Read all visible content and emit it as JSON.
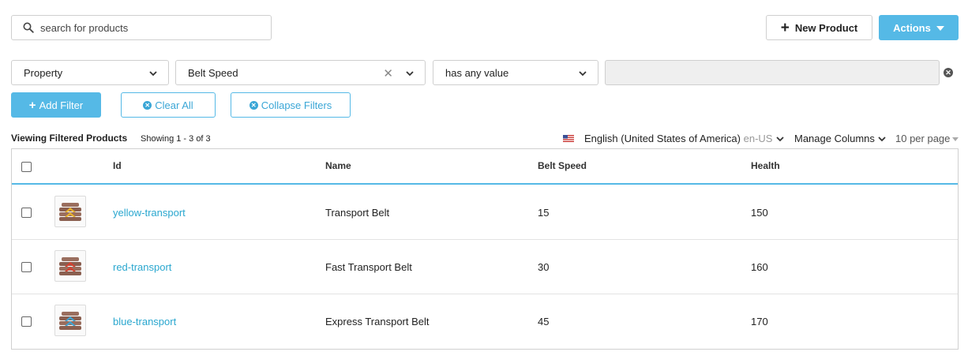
{
  "search": {
    "placeholder": "search for products"
  },
  "toolbar": {
    "new_product_label": "New Product",
    "actions_label": "Actions"
  },
  "filter": {
    "property_select": "Property",
    "attribute_select": "Belt Speed",
    "condition_select": "has any value",
    "value": ""
  },
  "filter_buttons": {
    "add_filter": "Add Filter",
    "clear_all": "Clear All",
    "collapse_filters": "Collapse Filters"
  },
  "listing": {
    "title": "Viewing Filtered Products",
    "showing": "Showing 1 - 3 of 3",
    "locale_name": "English (United States of America)",
    "locale_code": "en-US",
    "manage_columns": "Manage Columns",
    "per_page": "10 per page"
  },
  "table": {
    "headers": {
      "id": "Id",
      "name": "Name",
      "belt_speed": "Belt Speed",
      "health": "Health"
    },
    "rows": [
      {
        "id": "yellow-transport",
        "name": "Transport Belt",
        "belt_speed": "15",
        "health": "150",
        "accent": "#e8b22c"
      },
      {
        "id": "red-transport",
        "name": "Fast Transport Belt",
        "belt_speed": "30",
        "health": "160",
        "accent": "#d8402f"
      },
      {
        "id": "blue-transport",
        "name": "Express Transport Belt",
        "belt_speed": "45",
        "health": "170",
        "accent": "#3fa3d3"
      }
    ]
  },
  "colors": {
    "primary": "#55b9e6",
    "link": "#2aa7cf"
  },
  "icons": {
    "search": "search-icon",
    "plus": "plus-icon",
    "clear": "clear-icon",
    "remove_filter": "close-circle-icon",
    "flag": "us-flag-icon",
    "chevron": "chevron-down-icon",
    "thumbnail": "transport-belt-icon"
  }
}
